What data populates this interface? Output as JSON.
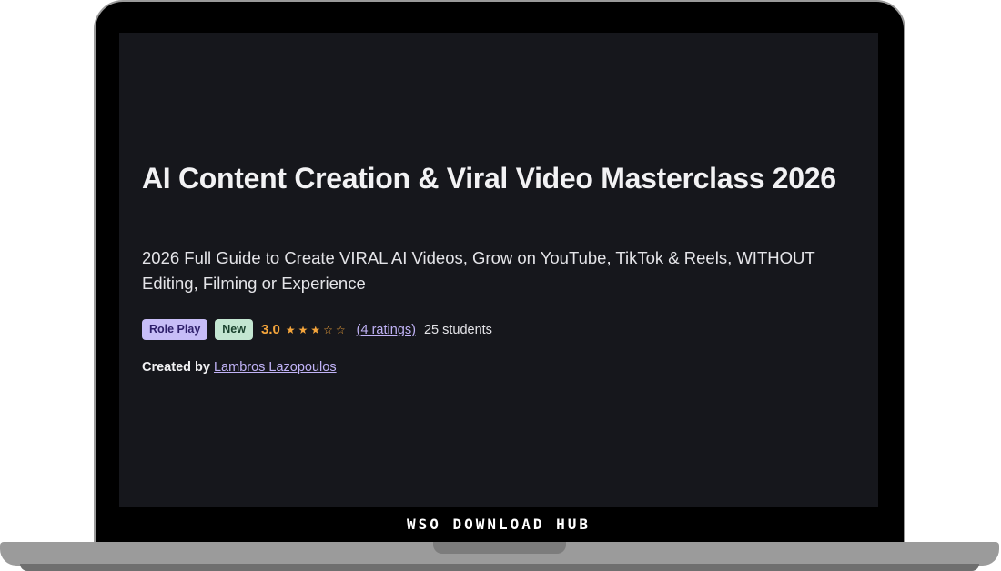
{
  "course": {
    "title": "AI Content Creation & Viral Video Masterclass 2026",
    "subtitle": "2026 Full Guide to Create VIRAL AI Videos, Grow on YouTube, TikTok & Reels, WITHOUT Editing, Filming or Experience",
    "badges": {
      "role_play": "Role Play",
      "new": "New"
    },
    "rating": {
      "value": "3.0",
      "stars": 3,
      "max_stars": 5,
      "ratings_text": "(4 ratings)"
    },
    "students": "25 students",
    "created_by_label": "Created by",
    "author": "Lambros Lazopoulos"
  },
  "watermark": "WSO DOWNLOAD HUB",
  "colors": {
    "screen_bg": "#16171c",
    "accent_link": "#c1b3f7",
    "rating_orange": "#f5a53b",
    "badge_role_bg": "#c7bdf7",
    "badge_new_bg": "#c3e6d1"
  }
}
